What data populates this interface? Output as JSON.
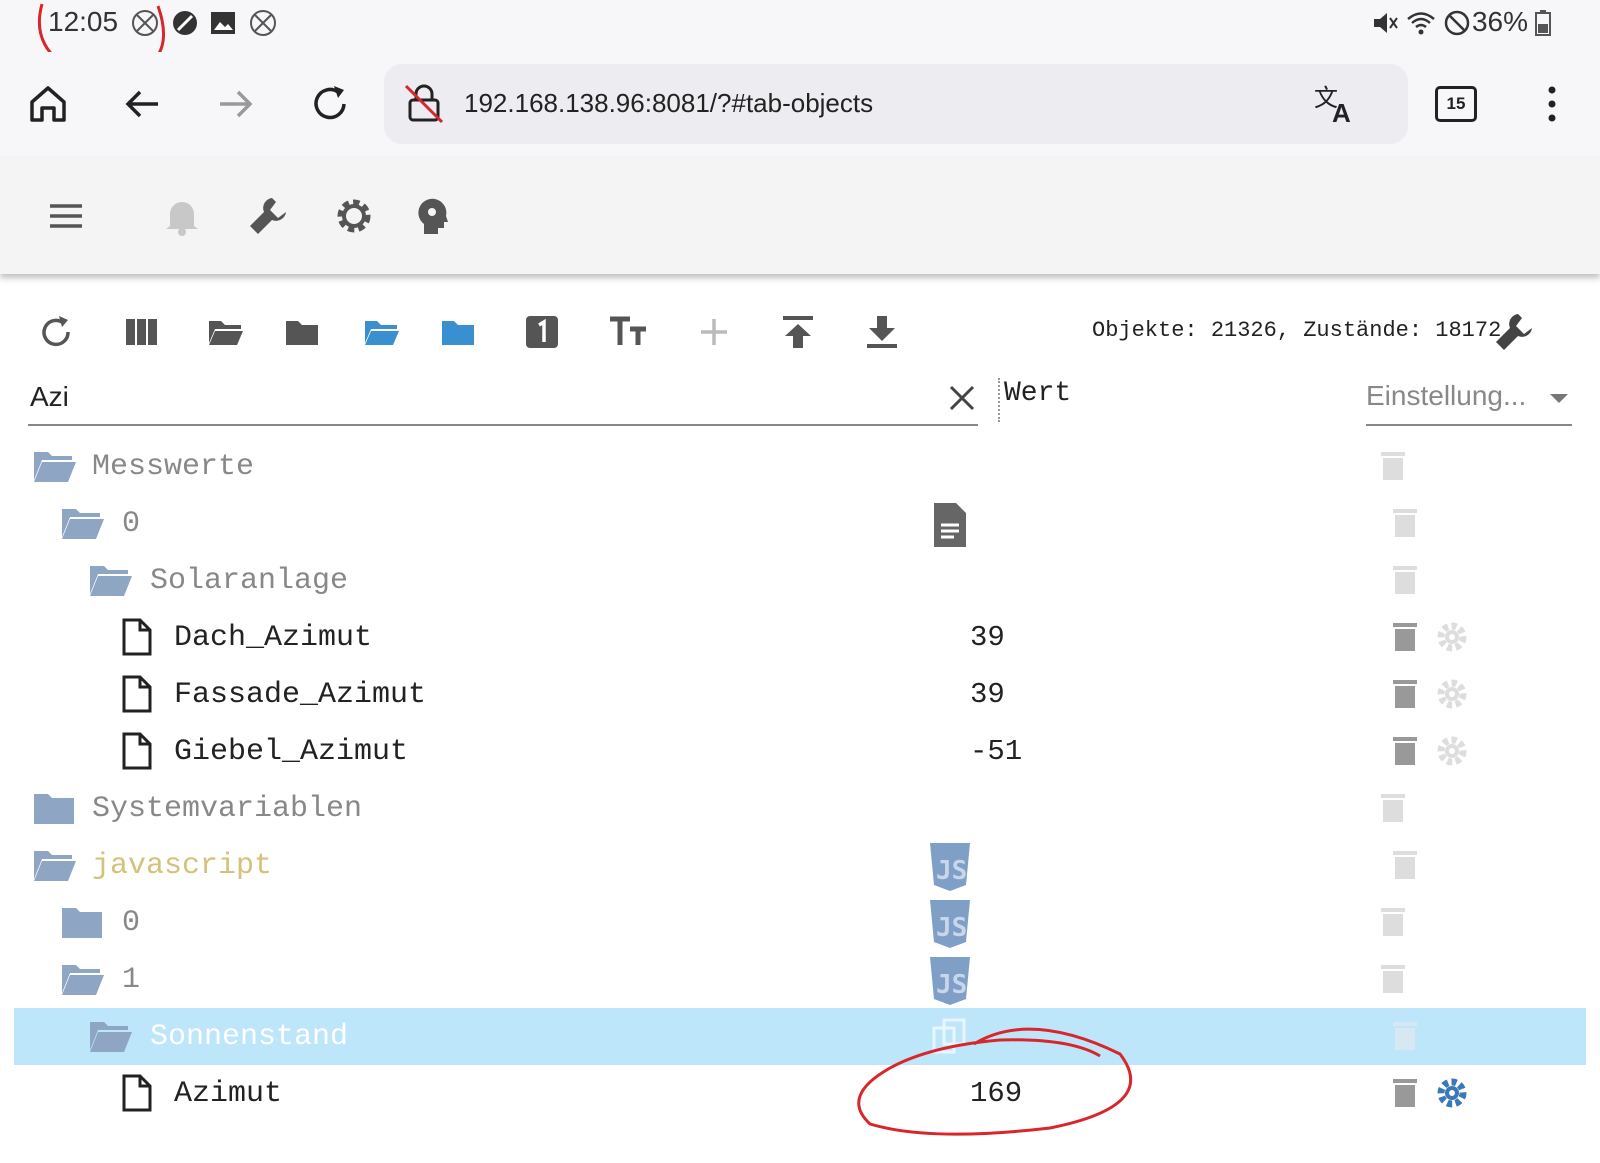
{
  "status_bar": {
    "time": "12:05",
    "battery": "36%",
    "icons": [
      "x-circle-icon",
      "no-camera-icon",
      "image-icon",
      "x-circle-icon",
      "mute-icon",
      "wifi-icon",
      "do-not-disturb-icon",
      "battery-icon"
    ]
  },
  "browser": {
    "url": "192.168.138.96:8081/?#tab-objects",
    "tabs_count": "15"
  },
  "objects": {
    "counts": "Objekte: 21326, Zustände: 18172",
    "search_value": "Azi",
    "column_value": "Wert",
    "settings_label": "Einstellung..."
  },
  "tree": {
    "messwerte": "Messwerte",
    "messwerte_0": "0",
    "solaranlage": "Solaranlage",
    "dach": "Dach_Azimut",
    "dach_val": "39",
    "fassade": "Fassade_Azimut",
    "fassade_val": "39",
    "giebel": "Giebel_Azimut",
    "giebel_val": "-51",
    "systemvariablen": "Systemvariablen",
    "javascript": "javascript",
    "js_0": "0",
    "js_1": "1",
    "sonnenstand": "Sonnenstand",
    "azimut": "Azimut",
    "azimut_val": "169"
  },
  "colors": {
    "selected_row": "#bde6fb",
    "folder": "#8fa5c4",
    "folder_active": "#3a8fd0",
    "annotation": "#d8262a"
  }
}
